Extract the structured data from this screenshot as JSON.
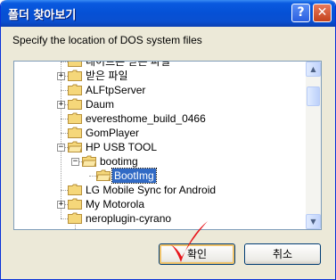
{
  "window": {
    "title": "폴더 찾아보기",
    "help_label": "?",
    "close_label": "✕"
  },
  "instruction": "Specify the location of DOS system files",
  "tree": {
    "items": [
      {
        "label": "네이트온 받은 파일",
        "level": 0,
        "expander": ""
      },
      {
        "label": "받은 파일",
        "level": 0,
        "expander": "+"
      },
      {
        "label": "ALFtpServer",
        "level": 0,
        "expander": ""
      },
      {
        "label": "Daum",
        "level": 0,
        "expander": "+"
      },
      {
        "label": "everesthome_build_0466",
        "level": 0,
        "expander": ""
      },
      {
        "label": "GomPlayer",
        "level": 0,
        "expander": ""
      },
      {
        "label": "HP USB TOOL",
        "level": 0,
        "expander": "−",
        "open": true
      },
      {
        "label": "bootimg",
        "level": 1,
        "expander": "−",
        "open": true
      },
      {
        "label": "BootImg",
        "level": 2,
        "expander": "",
        "selected": true,
        "open": true
      },
      {
        "label": "LG Mobile Sync for Android",
        "level": 0,
        "expander": ""
      },
      {
        "label": "My Motorola",
        "level": 0,
        "expander": "+"
      },
      {
        "label": "neroplugin-cyrano",
        "level": 0,
        "expander": ""
      }
    ]
  },
  "scrollbar": {
    "up_icon": "▲",
    "down_icon": "▼"
  },
  "buttons": {
    "ok_label": "확인",
    "cancel_label": "취소"
  },
  "colors": {
    "selection": "#316ac5",
    "folder": "#f5d77a",
    "check": "#e8151b"
  }
}
